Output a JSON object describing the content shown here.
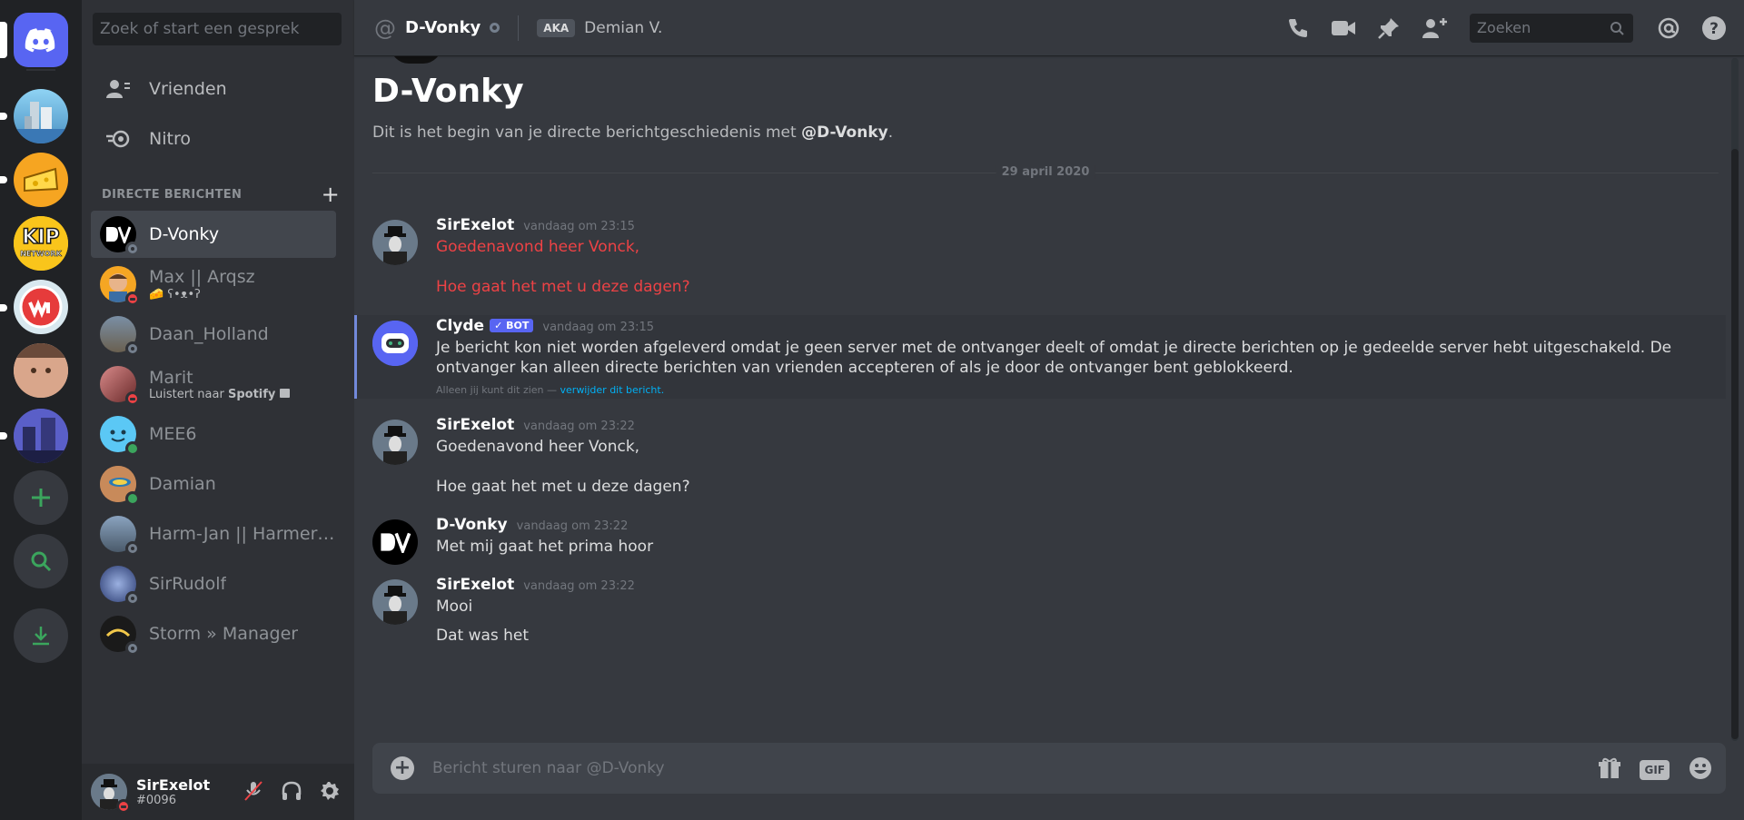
{
  "sidebar": {
    "search_placeholder": "Zoek of start een gesprek",
    "nav": [
      {
        "label": "Vrienden",
        "icon": "friends-icon"
      },
      {
        "label": "Nitro",
        "icon": "nitro-icon"
      }
    ],
    "dm_header": "DIRECTE BERICHTEN",
    "dms": [
      {
        "name": "D-Vonky",
        "status": "offline",
        "active": true
      },
      {
        "name": "Max || Arqsz",
        "status": "dnd",
        "sub": "🧀 ʕ•ᴥ•ʔ"
      },
      {
        "name": "Daan_Holland",
        "status": "offline"
      },
      {
        "name": "Marit",
        "status": "dnd",
        "sub_prefix": "Luistert naar ",
        "sub_bold": "Spotify"
      },
      {
        "name": "MEE6",
        "status": "online"
      },
      {
        "name": "Damian",
        "status": "online"
      },
      {
        "name": "Harm-Jan || Harmer2...",
        "status": "offline"
      },
      {
        "name": "SirRudolf",
        "status": "offline"
      },
      {
        "name": "Storm » Manager",
        "status": "offline"
      }
    ]
  },
  "user": {
    "name": "SirExelot",
    "tag": "#0096"
  },
  "header": {
    "channel": "D-Vonky",
    "aka_label": "AKA",
    "aka_name": "Demian V.",
    "search_placeholder": "Zoeken"
  },
  "intro": {
    "title": "D-Vonky",
    "desc_prefix": "Dit is het begin van je directe berichtgeschiedenis met ",
    "desc_mention": "@D-Vonky",
    "desc_suffix": "."
  },
  "date_divider": "29 april 2020",
  "messages": [
    {
      "author": "SirExelot",
      "time": "vandaag om 23:15",
      "lines": [
        "Goedenavond heer Vonck,",
        "",
        "Hoe gaat het met u deze dagen?"
      ],
      "failed": true
    },
    {
      "author": "Clyde",
      "bot_tag": "BOT",
      "time": "vandaag om 23:15",
      "lines": [
        "Je bericht kon niet worden afgeleverd omdat je geen server met de ontvanger deelt of omdat je directe berichten op je gedeelde server hebt uitgeschakeld. De",
        "ontvanger kan alleen directe berichten van vrienden accepteren of als je door de ontvanger bent geblokkeerd."
      ],
      "note_prefix": "Alleen jij kunt dit zien — ",
      "note_link": "verwijder dit bericht."
    },
    {
      "author": "SirExelot",
      "time": "vandaag om 23:22",
      "lines": [
        "Goedenavond heer Vonck,",
        "",
        "Hoe gaat het met u deze dagen?"
      ]
    },
    {
      "author": "D-Vonky",
      "time": "vandaag om 23:22",
      "lines": [
        "Met mij gaat het prima hoor"
      ]
    },
    {
      "author": "SirExelot",
      "time": "vandaag om 23:22",
      "lines": [
        "Mooi",
        "Dat was het"
      ]
    }
  ],
  "composer": {
    "placeholder": "Bericht sturen naar @D-Vonky",
    "gif_label": "GIF"
  },
  "colors": {
    "accent": "#5865f2",
    "error_text": "#ed4245",
    "link": "#00b0f4",
    "online": "#3ba55d",
    "dnd": "#ed4245",
    "offline": "#747f8d"
  }
}
